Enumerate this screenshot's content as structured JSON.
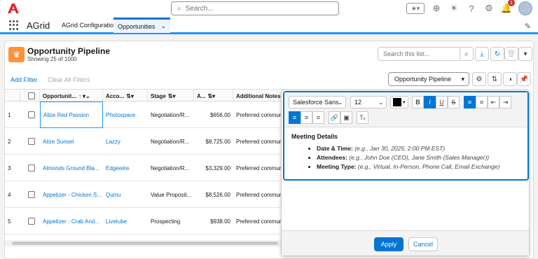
{
  "header": {
    "search_placeholder": "Search...",
    "notification_count": "1"
  },
  "nav": {
    "app_name": "AGrid",
    "items": [
      {
        "label": "AGrid Configuration"
      },
      {
        "label": "Opportunities"
      }
    ]
  },
  "card": {
    "title": "Opportunity Pipeline",
    "subtitle": "Showing 25 of 1000",
    "list_search_placeholder": "Search this list...",
    "add_filter": "Add Filter",
    "clear_filters": "Clear All Filters",
    "view_selected": "Opportunity Pipeline"
  },
  "grid": {
    "columns": [
      "Opportunit...",
      "Acco...",
      "Stage",
      "A...",
      "Additional Notes"
    ],
    "rows": [
      {
        "num": "1",
        "name": "Alize Red Passion",
        "account": "Photospace",
        "stage": "Negotiation/R...",
        "amount": "$656.00",
        "notes": "Preferred communic"
      },
      {
        "num": "2",
        "name": "Alize Sunset",
        "account": "Lazzy",
        "stage": "Negotiation/R...",
        "amount": "$8,725.00",
        "notes": "Preferred communic"
      },
      {
        "num": "3",
        "name": "Almonds Ground Bla...",
        "account": "Edgewire",
        "stage": "Negotiation/R...",
        "amount": "$3,329.00",
        "notes": "Preferred communic"
      },
      {
        "num": "4",
        "name": "Appetizer - Chicken S...",
        "account": "Quinu",
        "stage": "Value Proposit...",
        "amount": "$8,526.00",
        "notes": "Preferred communic"
      },
      {
        "num": "5",
        "name": "Appetizer - Crab And...",
        "account": "Livetube",
        "stage": "Prospecting",
        "amount": "$938.00",
        "notes": "Preferred communic"
      }
    ]
  },
  "editor": {
    "font_family": "Salesforce Sans",
    "font_size": "12",
    "text_color": "#000000",
    "heading": "Meeting Details",
    "items": [
      {
        "label": "Date & Time:",
        "hint": "(e.g., Jan 30, 2025, 2:00 PM EST)"
      },
      {
        "label": "Attendees:",
        "hint": "(e.g., John Doe (CEO), Jane Smith (Sales Manager))"
      },
      {
        "label": "Meeting Type:",
        "hint": "(e.g., Virtual, In-Person, Phone Call, Email Exchange)"
      }
    ],
    "apply_label": "Apply",
    "cancel_label": "Cancel"
  }
}
